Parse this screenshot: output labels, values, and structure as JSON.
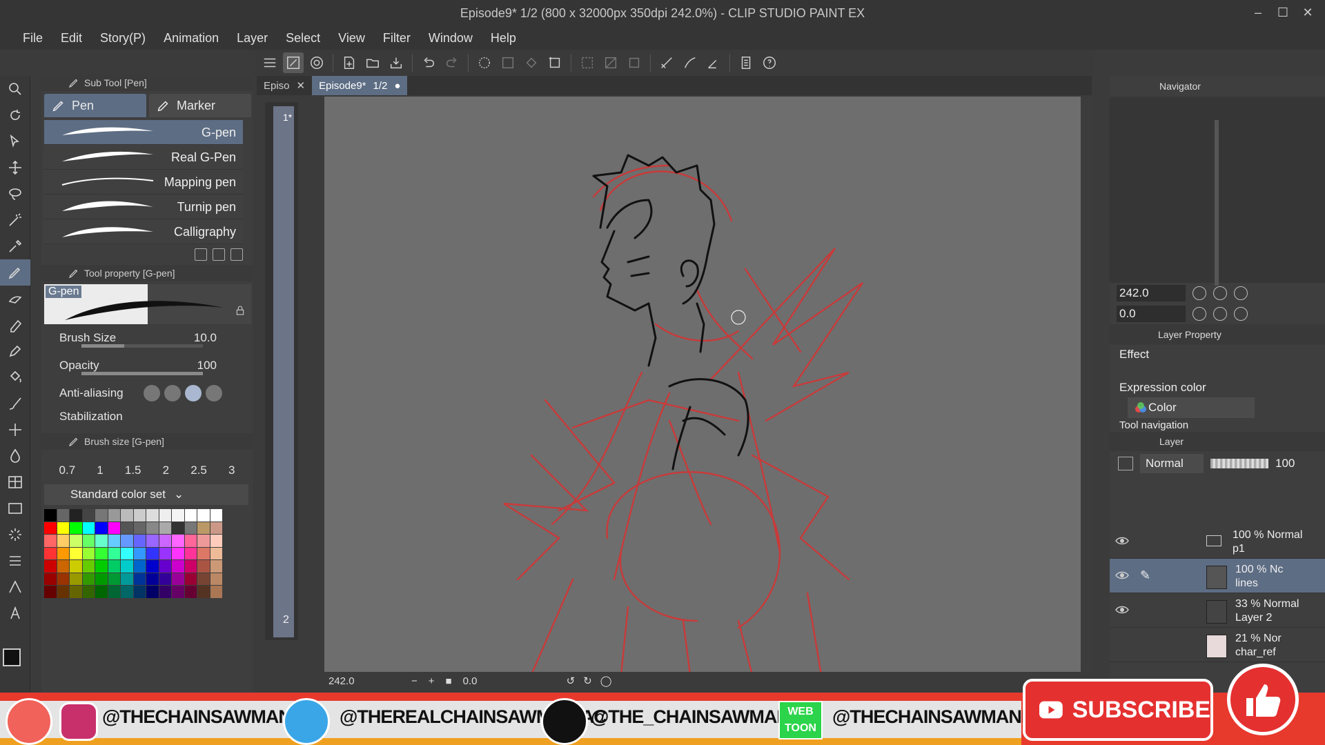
{
  "window": {
    "title": "Episode9* 1/2 (800 x 32000px 350dpi 242.0%) - CLIP STUDIO PAINT EX"
  },
  "menu": [
    "File",
    "Edit",
    "Story(P)",
    "Animation",
    "Layer",
    "Select",
    "View",
    "Filter",
    "Window",
    "Help"
  ],
  "subtool": {
    "header": "Sub Tool [Pen]",
    "tabs": [
      "Pen",
      "Marker"
    ],
    "brushes": [
      "G-pen",
      "Real G-Pen",
      "Mapping pen",
      "Turnip pen",
      "Calligraphy"
    ]
  },
  "toolprop": {
    "header": "Tool property [G-pen]",
    "preview_label": "G-pen",
    "brush_size_label": "Brush Size",
    "brush_size_value": "10.0",
    "brush_size_level": 0.35,
    "opacity_label": "Opacity",
    "opacity_value": "100",
    "opacity_level": 1.0,
    "antialias_label": "Anti-aliasing",
    "stabilization_label": "Stabilization"
  },
  "brushsize": {
    "header": "Brush size [G-pen]",
    "sizes": [
      "0.7",
      "1",
      "1.5",
      "2",
      "2.5",
      "3"
    ]
  },
  "colorset": {
    "name": "Standard color set"
  },
  "document": {
    "tab_prev": "Episo",
    "tab_active": "Episode9*",
    "tab_page": "1/2",
    "page_marker": "1*",
    "page_two": "2"
  },
  "status": {
    "zoom": "242.0",
    "rotation": "0.0"
  },
  "navigator": {
    "header": "Navigator",
    "zoom": "242.0",
    "rotation": "0.0"
  },
  "layerprop": {
    "header": "Layer Property",
    "effect_label": "Effect",
    "expression_label": "Expression color",
    "expression_value": "Color",
    "toolnav_label": "Tool navigation"
  },
  "layers": {
    "header": "Layer",
    "blend": "Normal",
    "opacity": "100",
    "items": [
      {
        "l1": "100 % Normal",
        "l2": "p1"
      },
      {
        "l1": "100 % Nc",
        "l2": "lines"
      },
      {
        "l1": "33 % Normal",
        "l2": "Layer 2"
      },
      {
        "l1": "21 % Nor",
        "l2": "char_ref"
      }
    ]
  },
  "social": {
    "handles": [
      "@THECHAINSAWMANIAC",
      "@THEREALCHAINSAWMANIAC",
      "@THE_CHAINSAWMANIAC",
      "@THECHAINSAWMANIAC"
    ],
    "webtoon_top": "WEB",
    "webtoon_bottom": "TOON",
    "subscribe": "SUBSCRIBE"
  },
  "colors": {
    "accent": "#5d6d84",
    "sketch_red": "#c93a3a",
    "lineart": "#111111"
  }
}
